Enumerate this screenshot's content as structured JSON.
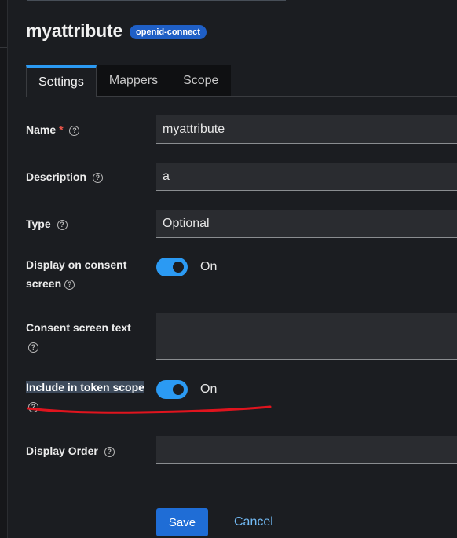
{
  "header": {
    "title": "myattribute",
    "badge": "openid-connect"
  },
  "tabs": [
    {
      "label": "Settings",
      "active": true
    },
    {
      "label": "Mappers",
      "active": false
    },
    {
      "label": "Scope",
      "active": false
    }
  ],
  "form": {
    "name": {
      "label": "Name",
      "required_mark": "*",
      "value": "myattribute"
    },
    "description": {
      "label": "Description",
      "value": "a"
    },
    "type": {
      "label": "Type",
      "value": "Optional"
    },
    "display_on_consent": {
      "label_line1": "Display on consent",
      "label_line2": "screen",
      "state": "On",
      "checked": true
    },
    "consent_screen_text": {
      "label": "Consent screen text",
      "value": ""
    },
    "include_in_token_scope": {
      "label": "Include in token scope",
      "state": "On",
      "checked": true
    },
    "display_order": {
      "label": "Display Order",
      "value": ""
    }
  },
  "actions": {
    "save": "Save",
    "cancel": "Cancel"
  },
  "help_glyph": "?",
  "colors": {
    "accent": "#2b9af3",
    "primary_button": "#1f6dd6",
    "annotation": "#e0141e",
    "background": "#1b1d21"
  },
  "icons": [
    "help-icon"
  ]
}
